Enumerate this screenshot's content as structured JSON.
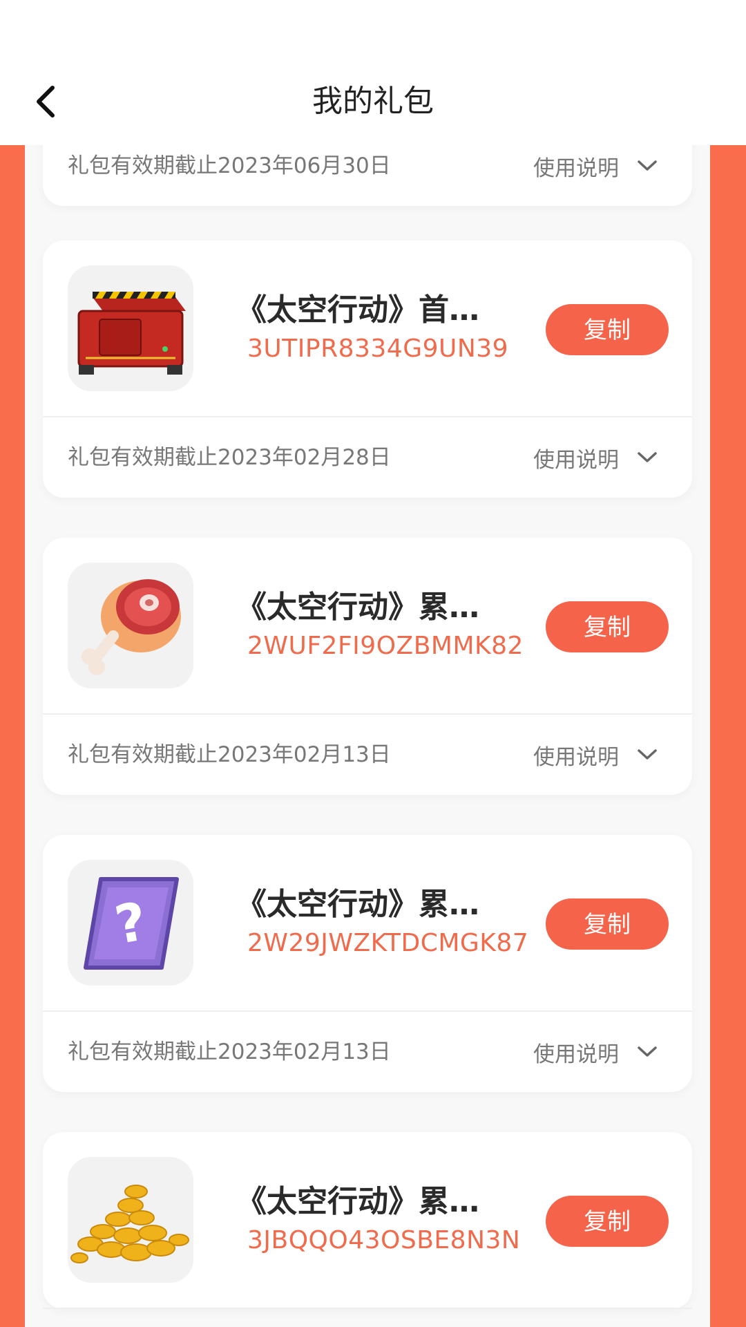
{
  "header": {
    "title": "我的礼包"
  },
  "usage_label": "使用说明",
  "copy_label": "复制",
  "colors": {
    "accent": "#f4634a",
    "side_background": "#fa6d4c",
    "code_text": "#f06a4c"
  },
  "cards": [
    {
      "expiry": "礼包有效期截止2023年06月30日"
    },
    {
      "name": "《太空行动》首发礼包",
      "code": "3UTIPR8334G9UN39",
      "icon": "red-crate-icon",
      "expiry": "礼包有效期截止2023年02月28日"
    },
    {
      "name": "《太空行动》累计…",
      "code": "2WUF2FI9OZBMMK82",
      "icon": "meat-drumstick-icon",
      "expiry": "礼包有效期截止2023年02月13日"
    },
    {
      "name": "《太空行动》累计…",
      "code": "2W29JWZKTDCMGK87",
      "icon": "mystery-box-icon",
      "expiry": "礼包有效期截止2023年02月13日"
    },
    {
      "name": "《太空行动》累计…",
      "code": "3JBQQO43OSBE8N3N",
      "icon": "gold-coins-icon"
    }
  ]
}
